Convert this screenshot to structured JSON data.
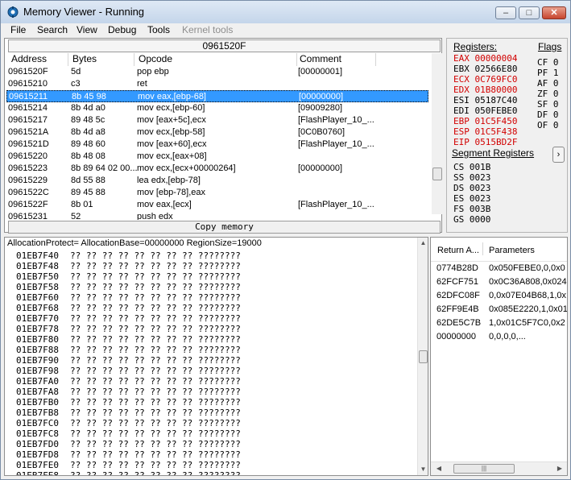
{
  "window": {
    "title": "Memory Viewer - Running",
    "min_label": "‒",
    "max_label": "□",
    "close_label": "✕"
  },
  "menu": [
    {
      "label": "File",
      "enabled": true
    },
    {
      "label": "Search",
      "enabled": true
    },
    {
      "label": "View",
      "enabled": true
    },
    {
      "label": "Debug",
      "enabled": true
    },
    {
      "label": "Tools",
      "enabled": true
    },
    {
      "label": "Kernel tools",
      "enabled": false
    }
  ],
  "disassembler": {
    "current_address": "0961520F",
    "columns": [
      "Address",
      "Bytes",
      "Opcode",
      "Comment"
    ],
    "rows": [
      {
        "address": "0961520F",
        "bytes": "5d",
        "opcode": "pop ebp",
        "comment": "[00000001]",
        "selected": false
      },
      {
        "address": "09615210",
        "bytes": "c3",
        "opcode": "ret",
        "comment": "",
        "selected": false
      },
      {
        "address": "09615211",
        "bytes": "8b 45 98",
        "opcode": "mov eax,[ebp-68]",
        "comment": "[00000000]",
        "selected": true
      },
      {
        "address": "09615214",
        "bytes": "8b 4d a0",
        "opcode": "mov ecx,[ebp-60]",
        "comment": "[09009280]",
        "selected": false
      },
      {
        "address": "09615217",
        "bytes": "89 48 5c",
        "opcode": "mov [eax+5c],ecx",
        "comment": "[FlashPlayer_10_...",
        "selected": false
      },
      {
        "address": "0961521A",
        "bytes": "8b 4d a8",
        "opcode": "mov ecx,[ebp-58]",
        "comment": "[0C0B0760]",
        "selected": false
      },
      {
        "address": "0961521D",
        "bytes": "89 48 60",
        "opcode": "mov [eax+60],ecx",
        "comment": "[FlashPlayer_10_...",
        "selected": false
      },
      {
        "address": "09615220",
        "bytes": "8b 48 08",
        "opcode": "mov ecx,[eax+08]",
        "comment": "",
        "selected": false
      },
      {
        "address": "09615223",
        "bytes": "8b 89 64 02 00...",
        "opcode": "mov ecx,[ecx+00000264]",
        "comment": "[00000000]",
        "selected": false
      },
      {
        "address": "09615229",
        "bytes": "8d 55 88",
        "opcode": "lea edx,[ebp-78]",
        "comment": "",
        "selected": false
      },
      {
        "address": "0961522C",
        "bytes": "89 45 88",
        "opcode": "mov [ebp-78],eax",
        "comment": "",
        "selected": false
      },
      {
        "address": "0961522F",
        "bytes": "8b 01",
        "opcode": "mov eax,[ecx]",
        "comment": "[FlashPlayer_10_...",
        "selected": false
      },
      {
        "address": "09615231",
        "bytes": "52",
        "opcode": "push edx",
        "comment": "",
        "selected": false
      }
    ],
    "copy_memory_label": "Copy memory"
  },
  "registers": {
    "label": "Registers:",
    "flags_label": "Flags",
    "list": [
      {
        "text": "EAX 00000004",
        "changed": true
      },
      {
        "text": "EBX 02566E80",
        "changed": false
      },
      {
        "text": "ECX 0C769FC0",
        "changed": true
      },
      {
        "text": "EDX 01B80000",
        "changed": true
      },
      {
        "text": "ESI 05187C40",
        "changed": false
      },
      {
        "text": "EDI 050FEBE0",
        "changed": false
      },
      {
        "text": "EBP 01C5F450",
        "changed": true
      },
      {
        "text": "ESP 01C5F438",
        "changed": true
      },
      {
        "text": "EIP 0515BD2F",
        "changed": true
      }
    ],
    "flags": [
      "CF 0",
      "PF 1",
      "AF 0",
      "ZF 0",
      "SF 0",
      "DF 0",
      "OF 0"
    ],
    "segment_label": "Segment Registers",
    "segments": [
      "CS 001B",
      "SS 0023",
      "DS 0023",
      "ES 0023",
      "FS 003B",
      "GS 0000"
    ],
    "expand_label": "›"
  },
  "hexview": {
    "alloc_info": "AllocationProtect= AllocationBase=00000000 RegionSize=19000",
    "unreadable_bytes": "?? ?? ?? ?? ?? ?? ?? ?? ????????",
    "rows": [
      "01EB7F40",
      "01EB7F48",
      "01EB7F50",
      "01EB7F58",
      "01EB7F60",
      "01EB7F68",
      "01EB7F70",
      "01EB7F78",
      "01EB7F80",
      "01EB7F88",
      "01EB7F90",
      "01EB7F98",
      "01EB7FA0",
      "01EB7FA8",
      "01EB7FB0",
      "01EB7FB8",
      "01EB7FC0",
      "01EB7FC8",
      "01EB7FD0",
      "01EB7FD8",
      "01EB7FE0",
      "01EB7FE8"
    ]
  },
  "stacktrace": {
    "columns": [
      "Return A...",
      "Parameters"
    ],
    "rows": [
      {
        "ret": "0774B28D",
        "params": "0x050FEBE0,0,0x0"
      },
      {
        "ret": "62FCF751",
        "params": "0x0C36A808,0x024"
      },
      {
        "ret": "62DFC08F",
        "params": "0,0x07E04B68,1,0x"
      },
      {
        "ret": "62FF9E4B",
        "params": "0x085E2220,1,0x01"
      },
      {
        "ret": "62DE5C7B",
        "params": "1,0x01C5F7C0,0x2"
      },
      {
        "ret": "00000000",
        "params": "0,0,0,0,..."
      }
    ],
    "scroll_left": "◀",
    "scroll_right": "▶",
    "scroll_grip": "|||"
  },
  "colors": {
    "selection": "#3399ff",
    "changed_register": "#d20000"
  }
}
